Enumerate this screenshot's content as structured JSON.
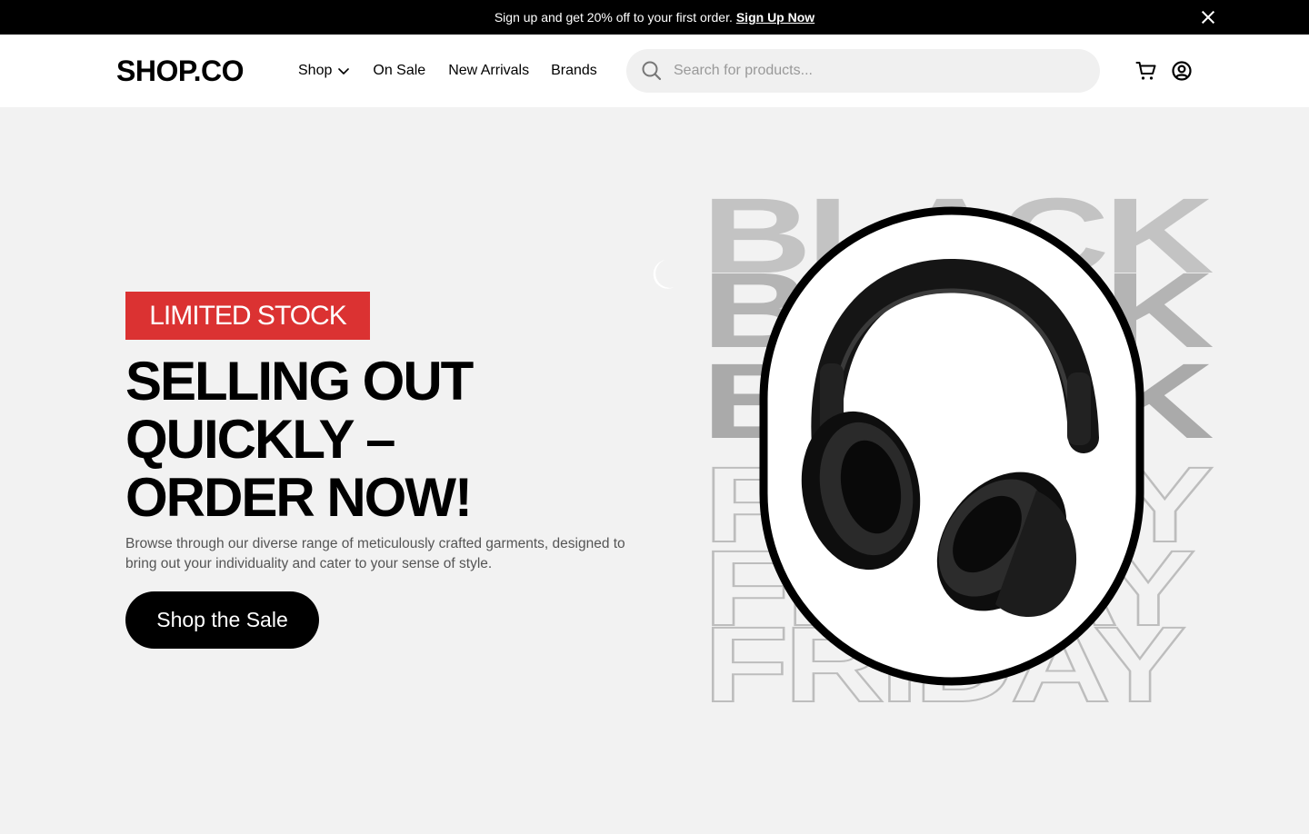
{
  "announcement": {
    "text": "Sign up and get 20% off to your first order.",
    "link": "Sign Up Now"
  },
  "header": {
    "logo": "SHOP.CO",
    "nav": {
      "shop": "Shop",
      "on_sale": "On Sale",
      "new_arrivals": "New Arrivals",
      "brands": "Brands"
    },
    "search": {
      "placeholder": "Search for products..."
    }
  },
  "hero": {
    "badge": "LIMITED STOCK",
    "headline": [
      "SELLING OUT",
      "QUICKLY –",
      "ORDER NOW!"
    ],
    "description": "Browse through our diverse range of meticulously crafted garments, designed to bring out your individuality and cater to your sense of style.",
    "cta": "Shop the Sale",
    "art_words": [
      "BLACK",
      "FRIDAY"
    ]
  },
  "colors": {
    "accent": "#db3232",
    "bar": "#000000",
    "page_bg": "#f2f2f2",
    "search_bg": "#f0f0f0"
  },
  "icons": [
    "close-icon",
    "chevron-down-icon",
    "search-icon",
    "cart-icon",
    "account-icon",
    "headphones-image"
  ]
}
